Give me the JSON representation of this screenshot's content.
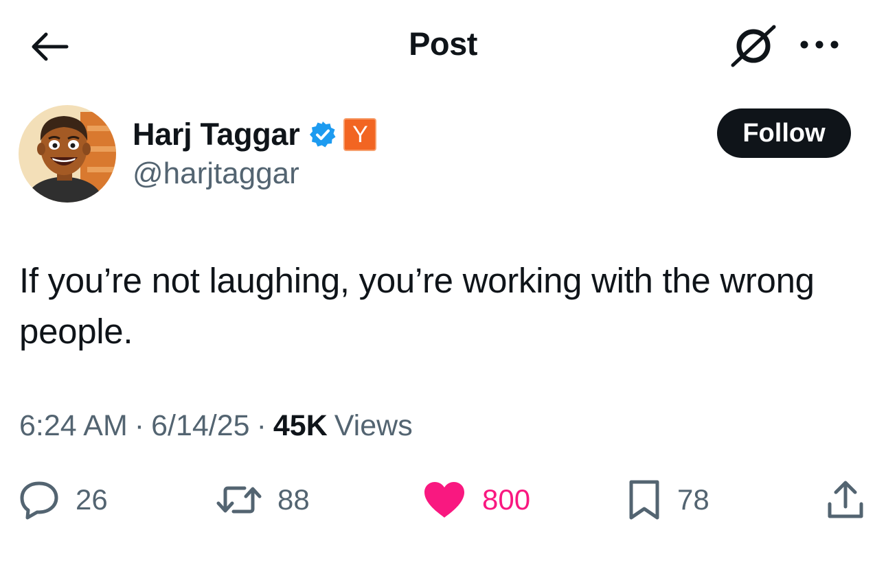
{
  "header": {
    "title": "Post"
  },
  "author": {
    "name": "Harj Taggar",
    "handle": "@harjtaggar",
    "yc_badge": "Y",
    "follow_label": "Follow"
  },
  "post": {
    "text": "If you’re not laughing, you’re working with the wrong people.",
    "time": "6:24 AM",
    "date": "6/14/25",
    "views_count": "45K",
    "views_label": "Views"
  },
  "actions": {
    "replies": "26",
    "reposts": "88",
    "likes": "800",
    "bookmarks": "78"
  },
  "colors": {
    "text_primary": "#0f1419",
    "text_secondary": "#536471",
    "verified_blue": "#1d9bf0",
    "like_pink": "#f91880",
    "yc_orange": "#f26522",
    "follow_bg": "#0f1419"
  },
  "icons": {
    "back": "arrow-left-icon",
    "grok": "grok-icon",
    "more": "more-horizontal-icon",
    "verified": "verified-check-icon",
    "reply": "reply-bubble-icon",
    "repost": "repost-arrows-icon",
    "like": "heart-filled-icon",
    "bookmark": "bookmark-icon",
    "share": "share-upload-icon"
  }
}
